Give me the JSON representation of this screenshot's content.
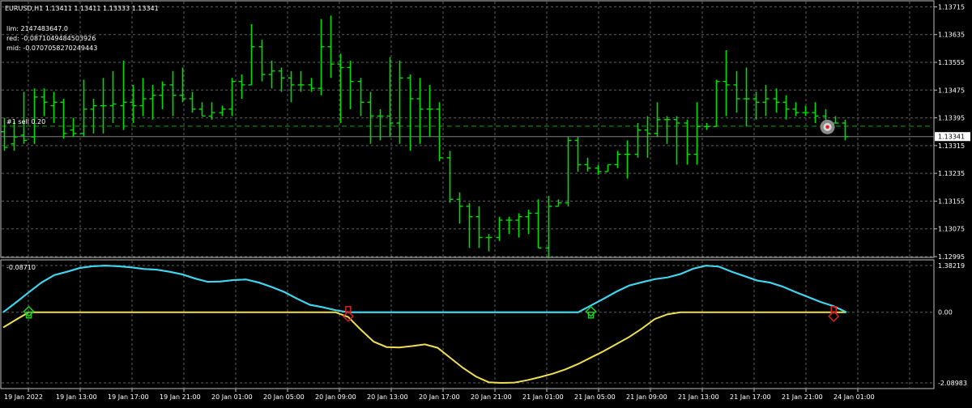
{
  "window": {
    "symbol_line": "EURUSD,H1  1.13411 1.13411 1.13333 1.13341"
  },
  "info_lines": [
    "lim: 2147483647.0",
    "red: -0.0871049484503926",
    "mid: -0.0707058270249443"
  ],
  "trade_line_label": "#1 sell 0.20",
  "current_price_label": "1.13341",
  "colors": {
    "background": "#000000",
    "grid": "#606060",
    "frame": "#c0c0c0",
    "bars": "#00dd00",
    "trade_line": "#00aa00",
    "cyan_line": "#3fd5ee",
    "yellow_line": "#f0e050",
    "buy_marker": "#22cc22",
    "sell_marker": "#dd2222",
    "text": "#ffffff"
  },
  "icons": {
    "trade_marker": "target-icon",
    "buy_signal": "diamond-up-icon",
    "sell_signal": "diamond-down-icon"
  },
  "price_axis": {
    "labels": [
      "1.13715",
      "1.13635",
      "1.13555",
      "1.13475",
      "1.13395",
      "1.13315",
      "1.13235",
      "1.13155",
      "1.13075",
      "1.12995"
    ]
  },
  "indicator": {
    "label_top_left": "-0.08710",
    "labels": [
      "1.38219",
      "0.00",
      "-2.08983"
    ]
  },
  "time_axis": {
    "labels": [
      "19 Jan 2022",
      "19 Jan 13:00",
      "19 Jan 17:00",
      "19 Jan 21:00",
      "20 Jan 01:00",
      "20 Jan 05:00",
      "20 Jan 09:00",
      "20 Jan 13:00",
      "20 Jan 17:00",
      "20 Jan 21:00",
      "21 Jan 01:00",
      "21 Jan 05:00",
      "21 Jan 09:00",
      "21 Jan 13:00",
      "21 Jan 17:00",
      "21 Jan 21:00",
      "24 Jan 01:00"
    ]
  },
  "chart_data": [
    {
      "type": "bar",
      "subtype": "ohlc",
      "title": "EURUSD,H1",
      "bars_ohlc": [
        [
          1.13355,
          1.13395,
          1.133,
          1.1331
        ],
        [
          1.1332,
          1.13385,
          1.133,
          1.1334
        ],
        [
          1.13345,
          1.1347,
          1.1332,
          1.1333
        ],
        [
          1.1334,
          1.1348,
          1.1332,
          1.13455
        ],
        [
          1.13455,
          1.1348,
          1.134,
          1.1344
        ],
        [
          1.1343,
          1.1347,
          1.1338,
          1.1344
        ],
        [
          1.1344,
          1.1345,
          1.13335,
          1.1335
        ],
        [
          1.1336,
          1.13395,
          1.1334,
          1.1335
        ],
        [
          1.1335,
          1.13505,
          1.1334,
          1.1342
        ],
        [
          1.1342,
          1.1345,
          1.1335,
          1.1343
        ],
        [
          1.1343,
          1.1351,
          1.1335,
          1.1343
        ],
        [
          1.1343,
          1.1353,
          1.1338,
          1.13435
        ],
        [
          1.1343,
          1.1356,
          1.1336,
          1.1344
        ],
        [
          1.1344,
          1.1349,
          1.1338,
          1.1343
        ],
        [
          1.1343,
          1.1351,
          1.134,
          1.1345
        ],
        [
          1.1345,
          1.1349,
          1.1339,
          1.1346
        ],
        [
          1.1346,
          1.135,
          1.1342,
          1.1349
        ],
        [
          1.1349,
          1.1353,
          1.134,
          1.1346
        ],
        [
          1.1346,
          1.1354,
          1.1344,
          1.1345
        ],
        [
          1.1345,
          1.1347,
          1.1341,
          1.1342
        ],
        [
          1.1342,
          1.1344,
          1.134,
          1.134
        ],
        [
          1.134,
          1.1344,
          1.1339,
          1.1341
        ],
        [
          1.1341,
          1.1343,
          1.134,
          1.1342
        ],
        [
          1.1342,
          1.1351,
          1.134,
          1.135
        ],
        [
          1.135,
          1.1352,
          1.1345,
          1.1349
        ],
        [
          1.1349,
          1.13665,
          1.1349,
          1.136
        ],
        [
          1.136,
          1.1362,
          1.135,
          1.1352
        ],
        [
          1.1352,
          1.1356,
          1.1348,
          1.1353
        ],
        [
          1.1353,
          1.1354,
          1.1347,
          1.1351
        ],
        [
          1.1351,
          1.1353,
          1.1344,
          1.1349
        ],
        [
          1.1349,
          1.1353,
          1.1347,
          1.1349
        ],
        [
          1.1349,
          1.1351,
          1.1347,
          1.1348
        ],
        [
          1.1348,
          1.1368,
          1.1346,
          1.136
        ],
        [
          1.136,
          1.1369,
          1.1351,
          1.1355
        ],
        [
          1.1355,
          1.1358,
          1.1338,
          1.1354
        ],
        [
          1.1354,
          1.1356,
          1.1342,
          1.135
        ],
        [
          1.135,
          1.1351,
          1.134,
          1.1344
        ],
        [
          1.1344,
          1.1347,
          1.1332,
          1.134
        ],
        [
          1.134,
          1.1342,
          1.1333,
          1.134
        ],
        [
          1.134,
          1.1357,
          1.1334,
          1.1338
        ],
        [
          1.1338,
          1.1356,
          1.1332,
          1.1351
        ],
        [
          1.1351,
          1.1352,
          1.133,
          1.1345
        ],
        [
          1.1345,
          1.1351,
          1.1332,
          1.1342
        ],
        [
          1.1342,
          1.1349,
          1.1334,
          1.1342
        ],
        [
          1.1342,
          1.1344,
          1.1327,
          1.1328
        ],
        [
          1.1328,
          1.133,
          1.1315,
          1.1316
        ],
        [
          1.1316,
          1.1318,
          1.1309,
          1.1314
        ],
        [
          1.1314,
          1.1315,
          1.1302,
          1.1311
        ],
        [
          1.1311,
          1.1314,
          1.1302,
          1.1305
        ],
        [
          1.1305,
          1.1306,
          1.1301,
          1.1305
        ],
        [
          1.1305,
          1.1311,
          1.1304,
          1.131
        ],
        [
          1.131,
          1.1311,
          1.1306,
          1.131
        ],
        [
          1.131,
          1.1312,
          1.1305,
          1.1311
        ],
        [
          1.1311,
          1.1313,
          1.1306,
          1.1312
        ],
        [
          1.1312,
          1.1316,
          1.1302,
          1.1302
        ],
        [
          1.1302,
          1.1317,
          1.1299,
          1.1314
        ],
        [
          1.1314,
          1.1316,
          1.1314,
          1.1315
        ],
        [
          1.1315,
          1.1334,
          1.1314,
          1.1333
        ],
        [
          1.1333,
          1.1334,
          1.1324,
          1.1326
        ],
        [
          1.1326,
          1.1328,
          1.1324,
          1.1325
        ],
        [
          1.1325,
          1.1326,
          1.1323,
          1.1324
        ],
        [
          1.1324,
          1.1326,
          1.1324,
          1.1326
        ],
        [
          1.1326,
          1.133,
          1.1325,
          1.1329
        ],
        [
          1.1329,
          1.1333,
          1.1322,
          1.1329
        ],
        [
          1.1329,
          1.1338,
          1.1328,
          1.1336
        ],
        [
          1.1336,
          1.134,
          1.1328,
          1.1335
        ],
        [
          1.1335,
          1.1344,
          1.1334,
          1.1339
        ],
        [
          1.1339,
          1.134,
          1.1332,
          1.1339
        ],
        [
          1.1339,
          1.134,
          1.1326,
          1.1338
        ],
        [
          1.1338,
          1.1339,
          1.1326,
          1.1329
        ],
        [
          1.1329,
          1.1344,
          1.1326,
          1.1337
        ],
        [
          1.1337,
          1.1338,
          1.1336,
          1.1337
        ],
        [
          1.1337,
          1.13505,
          1.1337,
          1.135
        ],
        [
          1.135,
          1.1359,
          1.134,
          1.1349
        ],
        [
          1.1349,
          1.1353,
          1.1341,
          1.1345
        ],
        [
          1.1345,
          1.1354,
          1.1337,
          1.1345
        ],
        [
          1.1345,
          1.1347,
          1.1339,
          1.1344
        ],
        [
          1.1344,
          1.1349,
          1.134,
          1.1345
        ],
        [
          1.1345,
          1.1348,
          1.1341,
          1.1344
        ],
        [
          1.1344,
          1.1346,
          1.1339,
          1.1342
        ],
        [
          1.1342,
          1.1344,
          1.134,
          1.1341
        ],
        [
          1.1341,
          1.1343,
          1.134,
          1.1341
        ],
        [
          1.1341,
          1.1344,
          1.1338,
          1.134
        ],
        [
          1.134,
          1.1342,
          1.1337,
          1.1338
        ],
        [
          1.1338,
          1.134,
          1.1338,
          1.1338
        ],
        [
          1.1338,
          1.1339,
          1.1333,
          1.13341
        ]
      ],
      "price_range": [
        1.12995,
        1.1373
      ],
      "trade_line_price": 1.13371,
      "current_price": 1.13341,
      "grid": true
    },
    {
      "type": "line",
      "series": [
        {
          "name": "",
          "color_key": "cyan_line",
          "values": [
            0.0,
            0.29,
            0.59,
            0.88,
            1.1,
            1.2,
            1.31,
            1.36,
            1.38,
            1.36,
            1.33,
            1.28,
            1.26,
            1.2,
            1.12,
            1.0,
            0.9,
            0.91,
            0.95,
            0.97,
            0.88,
            0.75,
            0.6,
            0.4,
            0.22,
            0.15,
            0.06,
            0.0,
            0.0,
            0.0,
            0.0,
            0.0,
            0.0,
            0.0,
            0.0,
            0.0,
            0.0,
            0.0,
            0.0,
            0.0,
            0.0,
            0.0,
            0.0,
            0.0,
            0.0,
            0.0,
            0.2,
            0.4,
            0.61,
            0.79,
            0.89,
            0.98,
            1.03,
            1.13,
            1.29,
            1.38,
            1.35,
            1.2,
            1.07,
            0.94,
            0.88,
            0.76,
            0.6,
            0.45,
            0.3,
            0.18,
            0.0
          ]
        },
        {
          "name": "",
          "color_key": "yellow_line",
          "values": [
            -0.45,
            -0.22,
            0.0,
            0.0,
            0.0,
            0.0,
            0.0,
            0.0,
            0.0,
            0.0,
            0.0,
            0.0,
            0.0,
            0.0,
            0.0,
            0.0,
            0.0,
            0.0,
            0.0,
            0.0,
            0.0,
            0.0,
            0.0,
            0.0,
            0.0,
            0.0,
            0.0,
            -0.14,
            -0.52,
            -0.87,
            -1.03,
            -1.04,
            -1.0,
            -0.95,
            -1.05,
            -1.35,
            -1.65,
            -1.9,
            -2.07,
            -2.09,
            -2.08,
            -2.01,
            -1.92,
            -1.82,
            -1.69,
            -1.53,
            -1.34,
            -1.15,
            -0.94,
            -0.73,
            -0.48,
            -0.2,
            -0.06,
            0.0,
            0.0,
            0.0,
            0.0,
            0.0,
            0.0,
            0.0,
            0.0,
            0.0,
            0.0,
            0.0,
            0.0,
            0.0,
            0.0
          ]
        }
      ],
      "ylim": [
        -2.08983,
        1.38219
      ],
      "signals": [
        {
          "type": "buy",
          "index": 2
        },
        {
          "type": "sell",
          "index": 27
        },
        {
          "type": "buy",
          "index": 46
        },
        {
          "type": "sell",
          "index": 65
        }
      ]
    }
  ]
}
